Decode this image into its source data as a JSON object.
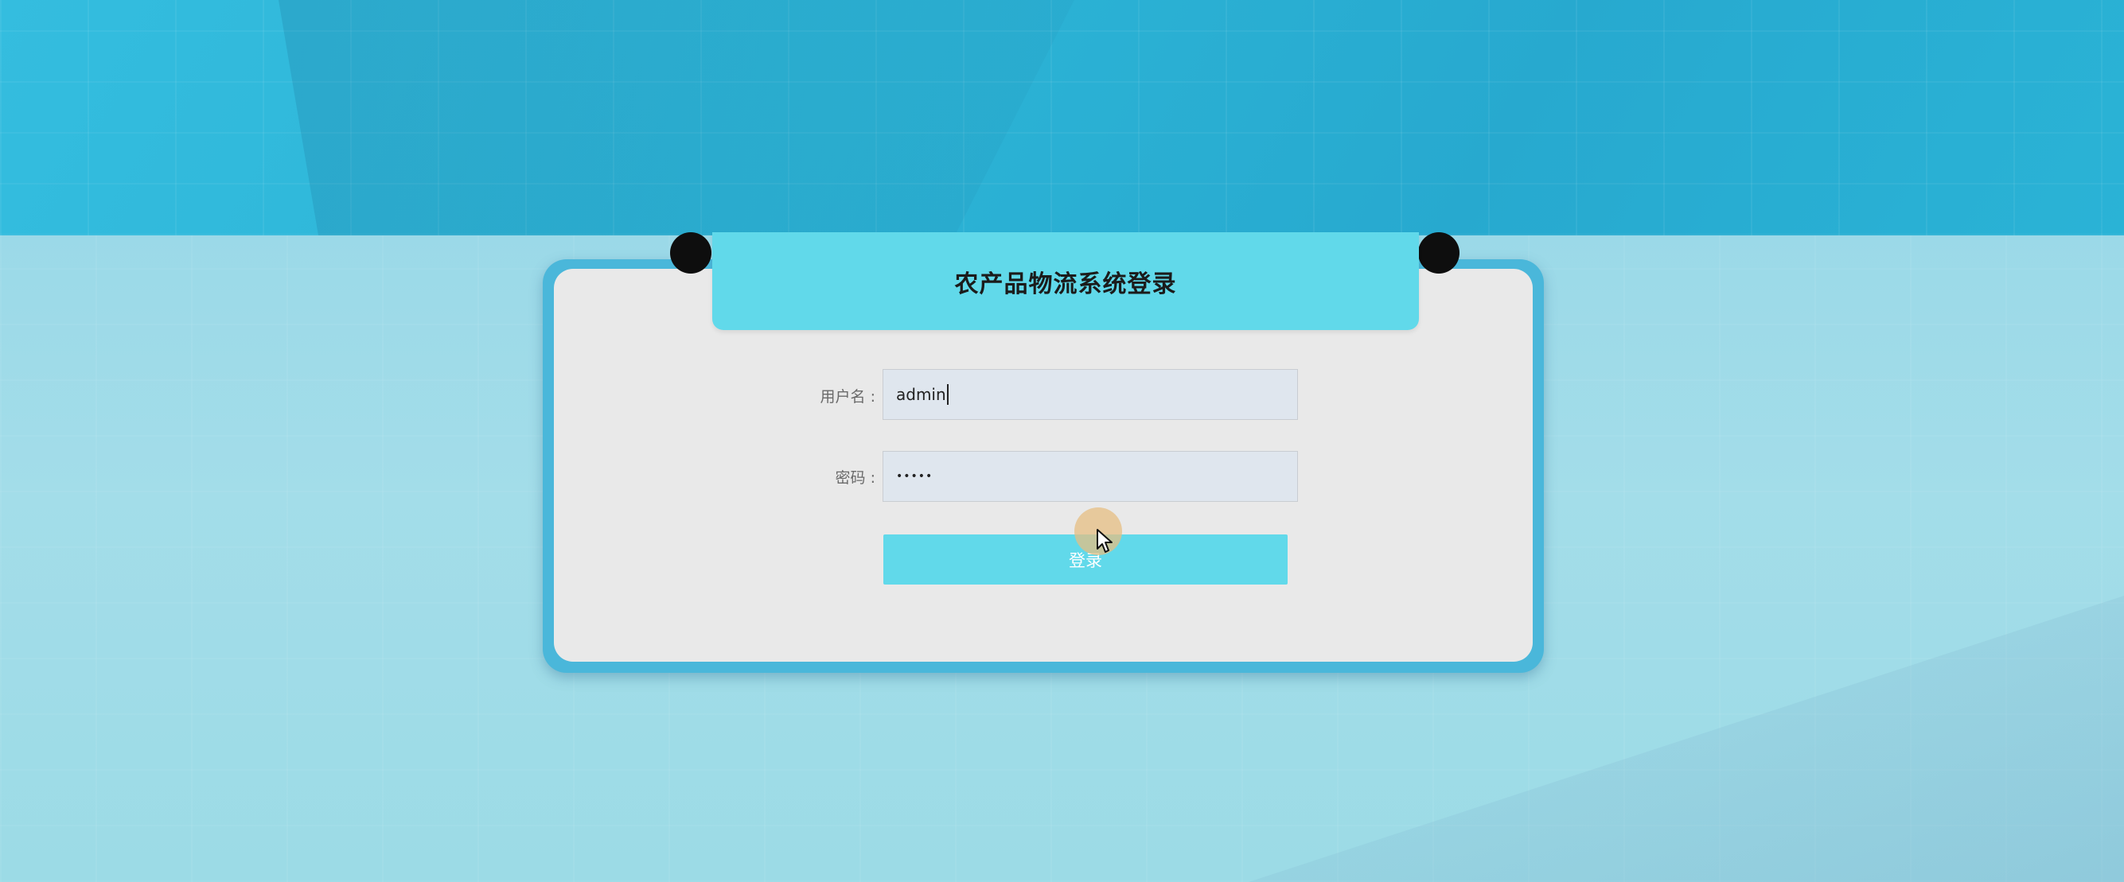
{
  "login": {
    "title": "农产品物流系统登录",
    "username_label": "用户名 :",
    "username_value": "admin",
    "password_label": "密码 :",
    "password_masked": "•••••",
    "submit_label": "登录"
  },
  "colors": {
    "accent": "#61d9ea",
    "card_border": "#4ab7da",
    "card_background": "#e9e9e9",
    "input_background": "#dfe6ee"
  }
}
